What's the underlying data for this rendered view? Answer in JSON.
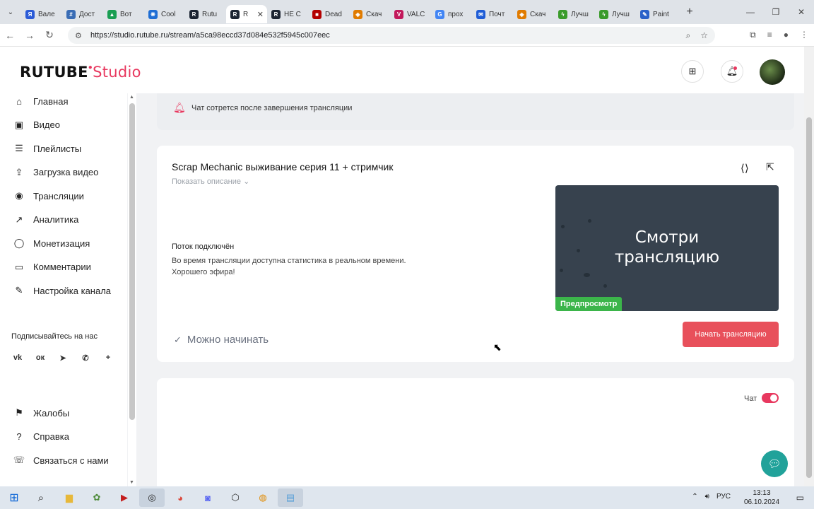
{
  "browser": {
    "tabs": [
      {
        "label": "Вале",
        "fav": "Я",
        "color": "#2b5bd7"
      },
      {
        "label": "Дост",
        "fav": "#",
        "color": "#3a6db5"
      },
      {
        "label": "Вот",
        "fav": "▲",
        "color": "#1a9e53"
      },
      {
        "label": "Cool",
        "fav": "❋",
        "color": "#1f6ed4"
      },
      {
        "label": "Rutu",
        "fav": "R",
        "color": "#1b2432"
      },
      {
        "label": "R",
        "fav": "R",
        "color": "#1b2432",
        "active": true
      },
      {
        "label": "НЕ С",
        "fav": "R",
        "color": "#1b2432"
      },
      {
        "label": "Dead",
        "fav": "■",
        "color": "#b30000"
      },
      {
        "label": "Скач",
        "fav": "◈",
        "color": "#e07b00"
      },
      {
        "label": "VALC",
        "fav": "V",
        "color": "#c2185b"
      },
      {
        "label": "прох",
        "fav": "G",
        "color": "#4285f4"
      },
      {
        "label": "Почт",
        "fav": "✉",
        "color": "#1e5cd6"
      },
      {
        "label": "Скач",
        "fav": "◈",
        "color": "#e07b00"
      },
      {
        "label": "Лучш",
        "fav": "ϟ",
        "color": "#3a9b2b"
      },
      {
        "label": "Лучш",
        "fav": "ϟ",
        "color": "#3a9b2b"
      },
      {
        "label": "Paint",
        "fav": "✎",
        "color": "#2b62c9"
      }
    ],
    "url": "https://studio.rutube.ru/stream/a5ca98eccd37d084e532f5945c007eec"
  },
  "header": {
    "logo_main": "RUTUBE",
    "logo_sub": "Studio"
  },
  "sidebar": {
    "items": [
      {
        "label": "Главная",
        "icon": "home-icon",
        "glyph": "⌂"
      },
      {
        "label": "Видео",
        "icon": "video-icon",
        "glyph": "▣"
      },
      {
        "label": "Плейлисты",
        "icon": "playlist-icon",
        "glyph": "☰"
      },
      {
        "label": "Загрузка видео",
        "icon": "upload-icon",
        "glyph": "⇪"
      },
      {
        "label": "Трансляции",
        "icon": "broadcast-icon",
        "glyph": "◉"
      },
      {
        "label": "Аналитика",
        "icon": "analytics-icon",
        "glyph": "↗"
      },
      {
        "label": "Монетизация",
        "icon": "monetization-icon",
        "glyph": "◯"
      },
      {
        "label": "Комментарии",
        "icon": "comments-icon",
        "glyph": "▭"
      },
      {
        "label": "Настройка канала",
        "icon": "settings-icon",
        "glyph": "✎"
      }
    ],
    "subscribe_title": "Подписывайтесь на нас",
    "socials": [
      "vk",
      "ok",
      "telegram",
      "viber",
      "more"
    ],
    "bottom_items": [
      {
        "label": "Жалобы",
        "icon": "flag-icon",
        "glyph": "⚑"
      },
      {
        "label": "Справка",
        "icon": "help-icon",
        "glyph": "?"
      },
      {
        "label": "Связаться с нами",
        "icon": "contact-icon",
        "glyph": "☏"
      }
    ]
  },
  "notice": {
    "text": "Чат сотрется после завершения трансляции"
  },
  "stream": {
    "title": "Scrap Mechanic выживание серия 11 + стримчик",
    "show_description": "Показать описание",
    "status_title": "Поток подключён",
    "status_text": "Во время трансляции доступна статистика в реальном времени. Хорошего эфира!",
    "ready_text": "Можно начинать",
    "preview_line1": "Смотри",
    "preview_line2": "трансляцию",
    "preview_badge": "Предпросмотр",
    "start_button": "Начать трансляцию"
  },
  "chat": {
    "label": "Чат",
    "enabled": true
  },
  "taskbar": {
    "language": "РУС",
    "time": "13:13",
    "date": "06.10.2024"
  },
  "colors": {
    "accent": "#e8385f",
    "start_button": "#e8505b",
    "preview_badge": "#3bb54a",
    "support": "#21a29a"
  }
}
